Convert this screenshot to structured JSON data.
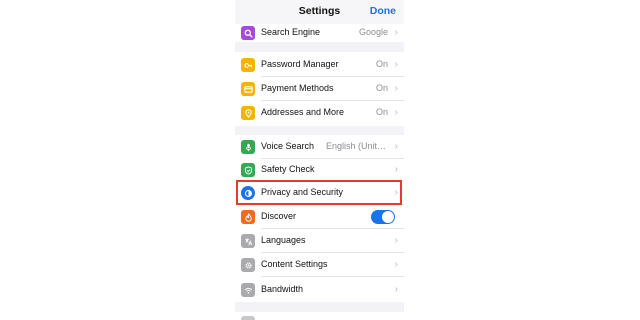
{
  "nav": {
    "title": "Settings",
    "done_label": "Done"
  },
  "rows": [
    {
      "label": "Search Engine",
      "value": "Google",
      "icon": "search-icon",
      "color": "#a54bd9"
    },
    {
      "label": "Password Manager",
      "value": "On",
      "icon": "key-icon",
      "color": "#f4b400"
    },
    {
      "label": "Payment Methods",
      "value": "On",
      "icon": "card-icon",
      "color": "#f4b400"
    },
    {
      "label": "Addresses and More",
      "value": "On",
      "icon": "location-pin-icon",
      "color": "#f4b400"
    },
    {
      "label": "Voice Search",
      "value": "English (United States)",
      "icon": "microphone-icon",
      "color": "#34a853"
    },
    {
      "label": "Safety Check",
      "value": "",
      "icon": "shield-check-icon",
      "color": "#34a853"
    },
    {
      "label": "Privacy and Security",
      "value": "",
      "icon": "privacy-shield-icon",
      "color": "#1a73e8"
    },
    {
      "label": "Discover",
      "value": "",
      "icon": "discover-flame-icon",
      "color": "#f26b1d",
      "toggle_on": true
    },
    {
      "label": "Languages",
      "value": "",
      "icon": "translate-icon",
      "color": "#a9a9ae"
    },
    {
      "label": "Content Settings",
      "value": "",
      "icon": "gear-icon",
      "color": "#a9a9ae"
    },
    {
      "label": "Bandwidth",
      "value": "",
      "icon": "wifi-icon",
      "color": "#a9a9ae"
    }
  ],
  "colors": {
    "accent": "#1a73e8",
    "highlight": "#e8372c"
  }
}
